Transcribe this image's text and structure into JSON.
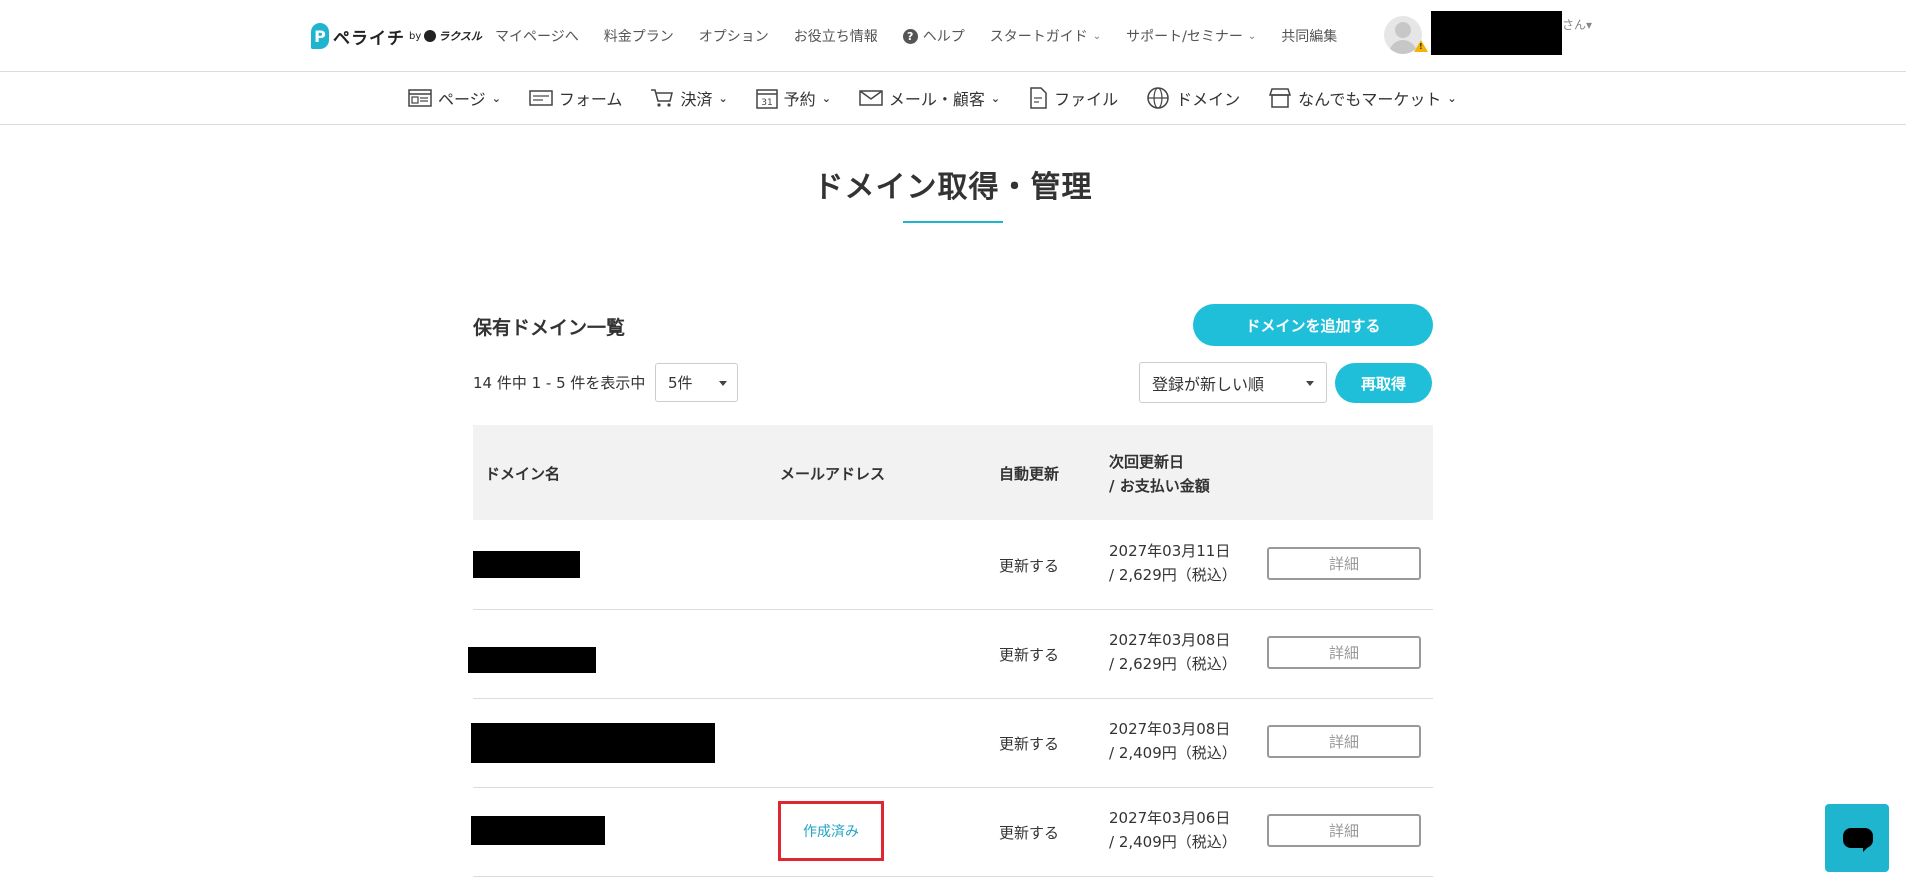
{
  "header": {
    "logo_text": "ペライチ",
    "logo_by": "by",
    "logo_brand2": "ラクスル",
    "nav": [
      {
        "label": "マイページへ"
      },
      {
        "label": "料金プラン"
      },
      {
        "label": "オプション"
      },
      {
        "label": "お役立ち情報"
      },
      {
        "label": "ヘルプ"
      },
      {
        "label": "スタートガイド"
      },
      {
        "label": "サポート/セミナー"
      },
      {
        "label": "共同編集"
      }
    ],
    "user_suffix": "さん"
  },
  "secondary_nav": [
    {
      "label": "ページ",
      "icon": "page-icon"
    },
    {
      "label": "フォーム",
      "icon": "form-icon"
    },
    {
      "label": "決済",
      "icon": "cart-icon"
    },
    {
      "label": "予約",
      "icon": "calendar-icon"
    },
    {
      "label": "メール・顧客",
      "icon": "mail-icon"
    },
    {
      "label": "ファイル",
      "icon": "file-icon"
    },
    {
      "label": "ドメイン",
      "icon": "globe-icon"
    },
    {
      "label": "なんでもマーケット",
      "icon": "store-icon"
    }
  ],
  "calendar_icon_text": "31",
  "page": {
    "title": "ドメイン取得・管理",
    "section_title": "保有ドメイン一覧",
    "add_button": "ドメインを追加する",
    "count_text": "14 件中 1 - 5 件を表示中",
    "per_page": "5件",
    "sort": "登録が新しい順",
    "refetch_button": "再取得"
  },
  "table": {
    "headers": {
      "domain": "ドメイン名",
      "mail": "メールアドレス",
      "auto": "自動更新",
      "next_line1": "次回更新日",
      "next_line2": "/ お支払い金額"
    },
    "rows": [
      {
        "auto": "更新する",
        "date": "2027年03月11日",
        "price": "/ 2,629円（税込）",
        "detail": "詳細",
        "mail": ""
      },
      {
        "auto": "更新する",
        "date": "2027年03月08日",
        "price": "/ 2,629円（税込）",
        "detail": "詳細",
        "mail": ""
      },
      {
        "auto": "更新する",
        "date": "2027年03月08日",
        "price": "/ 2,409円（税込）",
        "detail": "詳細",
        "mail": ""
      },
      {
        "auto": "更新する",
        "date": "2027年03月06日",
        "price": "/ 2,409円（税込）",
        "detail": "詳細",
        "mail": "作成済み"
      }
    ]
  },
  "colors": {
    "accent": "#1fbfd9",
    "highlight": "#e0262e"
  }
}
